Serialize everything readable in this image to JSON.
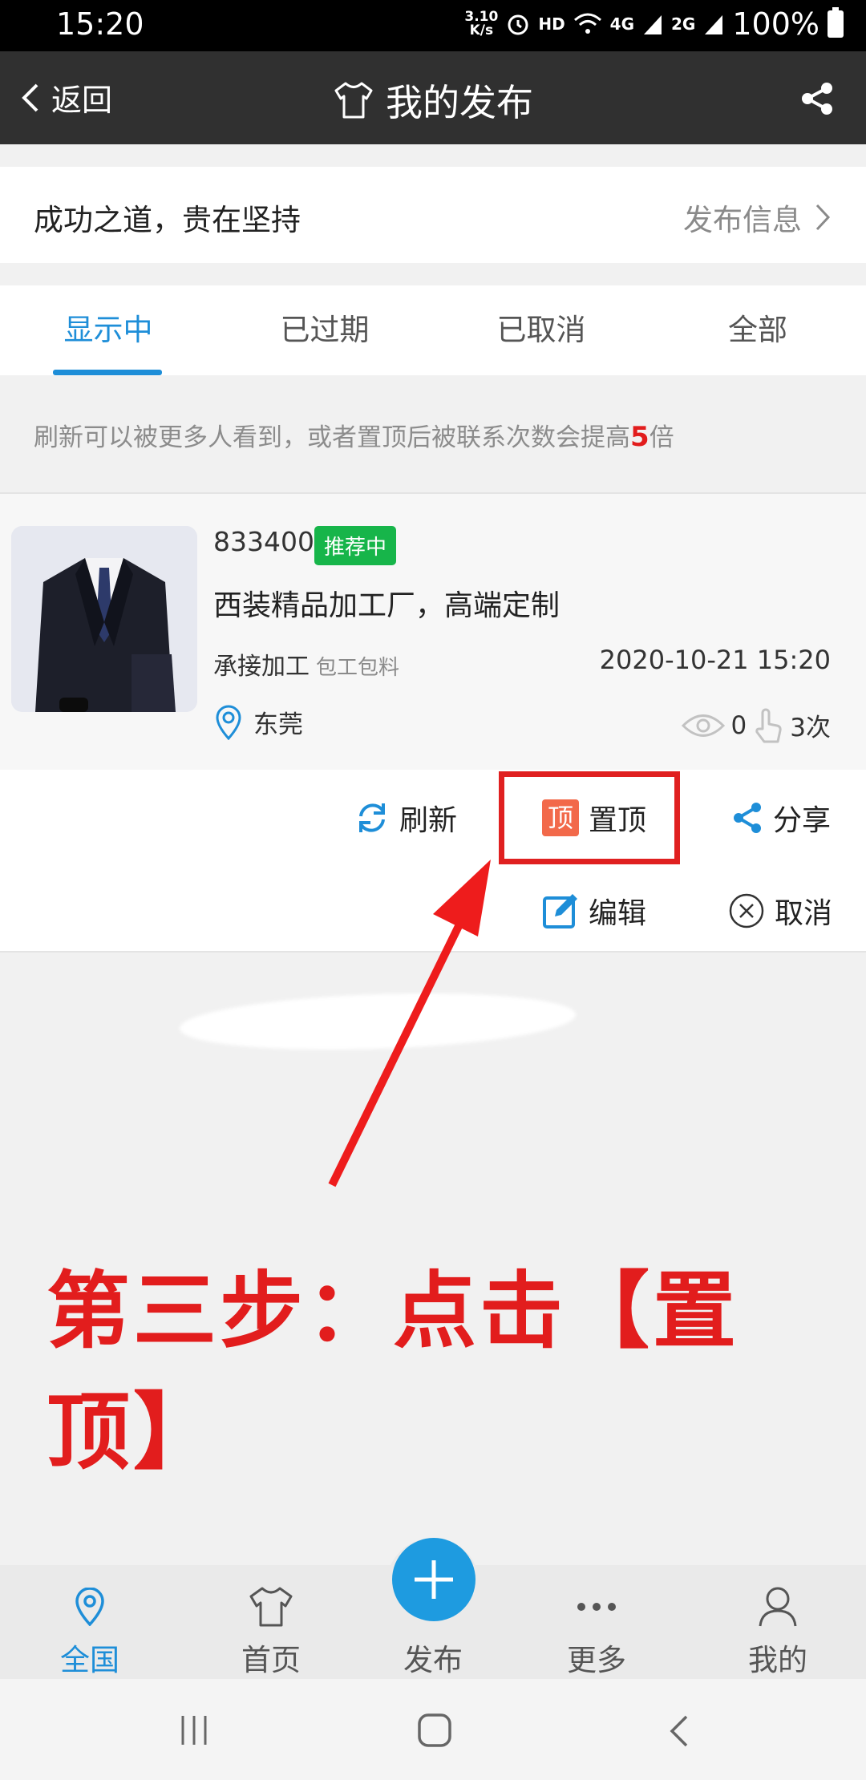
{
  "status_bar": {
    "time": "15:20",
    "speed_top": "3.10",
    "speed_bottom": "K/s",
    "hd": "HD",
    "net1": "4G",
    "net2": "2G",
    "battery": "100%"
  },
  "header": {
    "back_label": "返回",
    "title": "我的发布"
  },
  "slogan": {
    "text": "成功之道，贵在坚持",
    "link": "发布信息"
  },
  "tabs": [
    {
      "label": "显示中",
      "active": true
    },
    {
      "label": "已过期",
      "active": false
    },
    {
      "label": "已取消",
      "active": false
    },
    {
      "label": "全部",
      "active": false
    }
  ],
  "notice": {
    "before": "刷新可以被更多人看到，或者置顶后被联系次数会提高",
    "highlight": "5",
    "after": "倍"
  },
  "post": {
    "id": "833400",
    "badge": "推荐中",
    "title": "西装精品加工厂，高端定制",
    "category": "承接加工",
    "category_sub": "包工包料",
    "time": "2020-10-21 15:20",
    "location": "东莞",
    "views": "0",
    "contacts": "3次"
  },
  "actions": {
    "refresh": "刷新",
    "top_icon": "顶",
    "top": "置顶",
    "share": "分享",
    "edit": "编辑",
    "cancel": "取消"
  },
  "annotation": {
    "text": "第三步：点击【置顶】"
  },
  "bottom_nav": {
    "nation": "全国",
    "home": "首页",
    "publish": "发布",
    "more": "更多",
    "mine": "我的"
  },
  "colors": {
    "accent": "#1e8ed8",
    "red": "#e21d1d",
    "badge": "#17b54a",
    "top_icon": "#f2694a"
  }
}
